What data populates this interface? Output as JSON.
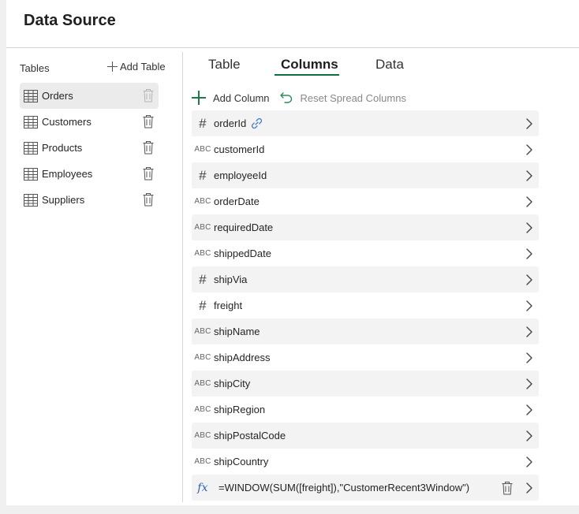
{
  "header": {
    "title": "Data Source"
  },
  "sidebar": {
    "label": "Tables",
    "add_label": "Add Table",
    "items": [
      {
        "label": "Orders",
        "active": true
      },
      {
        "label": "Customers",
        "active": false
      },
      {
        "label": "Products",
        "active": false
      },
      {
        "label": "Employees",
        "active": false
      },
      {
        "label": "Suppliers",
        "active": false
      }
    ]
  },
  "tabs": [
    {
      "label": "Table",
      "active": false
    },
    {
      "label": "Columns",
      "active": true
    },
    {
      "label": "Data",
      "active": false
    }
  ],
  "toolbar": {
    "add_column_label": "Add Column",
    "reset_label": "Reset Spread Columns"
  },
  "columns": [
    {
      "name": "orderId",
      "type": "hash",
      "type_label": "#",
      "linked": true
    },
    {
      "name": "customerId",
      "type": "text",
      "type_label": "ABC"
    },
    {
      "name": "employeeId",
      "type": "hash",
      "type_label": "#"
    },
    {
      "name": "orderDate",
      "type": "text",
      "type_label": "ABC"
    },
    {
      "name": "requiredDate",
      "type": "text",
      "type_label": "ABC"
    },
    {
      "name": "shippedDate",
      "type": "text",
      "type_label": "ABC"
    },
    {
      "name": "shipVia",
      "type": "hash",
      "type_label": "#"
    },
    {
      "name": "freight",
      "type": "hash",
      "type_label": "#"
    },
    {
      "name": "shipName",
      "type": "text",
      "type_label": "ABC"
    },
    {
      "name": "shipAddress",
      "type": "text",
      "type_label": "ABC"
    },
    {
      "name": "shipCity",
      "type": "text",
      "type_label": "ABC"
    },
    {
      "name": "shipRegion",
      "type": "text",
      "type_label": "ABC"
    },
    {
      "name": "shipPostalCode",
      "type": "text",
      "type_label": "ABC"
    },
    {
      "name": "shipCountry",
      "type": "text",
      "type_label": "ABC"
    },
    {
      "name": "=WINDOW(SUM([freight]),\"CustomerRecent3Window\")",
      "type": "formula",
      "type_label": "fx",
      "deletable": true
    }
  ],
  "colors": {
    "accent": "#0f6e3f",
    "add_icon": "#1e7a46",
    "link_icon": "#3a78c9",
    "fx_icon": "#2b63b5"
  },
  "icons": {
    "table": "table-grid-icon",
    "delete": "trash-icon",
    "add": "plus-icon",
    "reset": "undo-arrow-icon",
    "link": "link-icon",
    "expand": "chevron-right-icon"
  }
}
